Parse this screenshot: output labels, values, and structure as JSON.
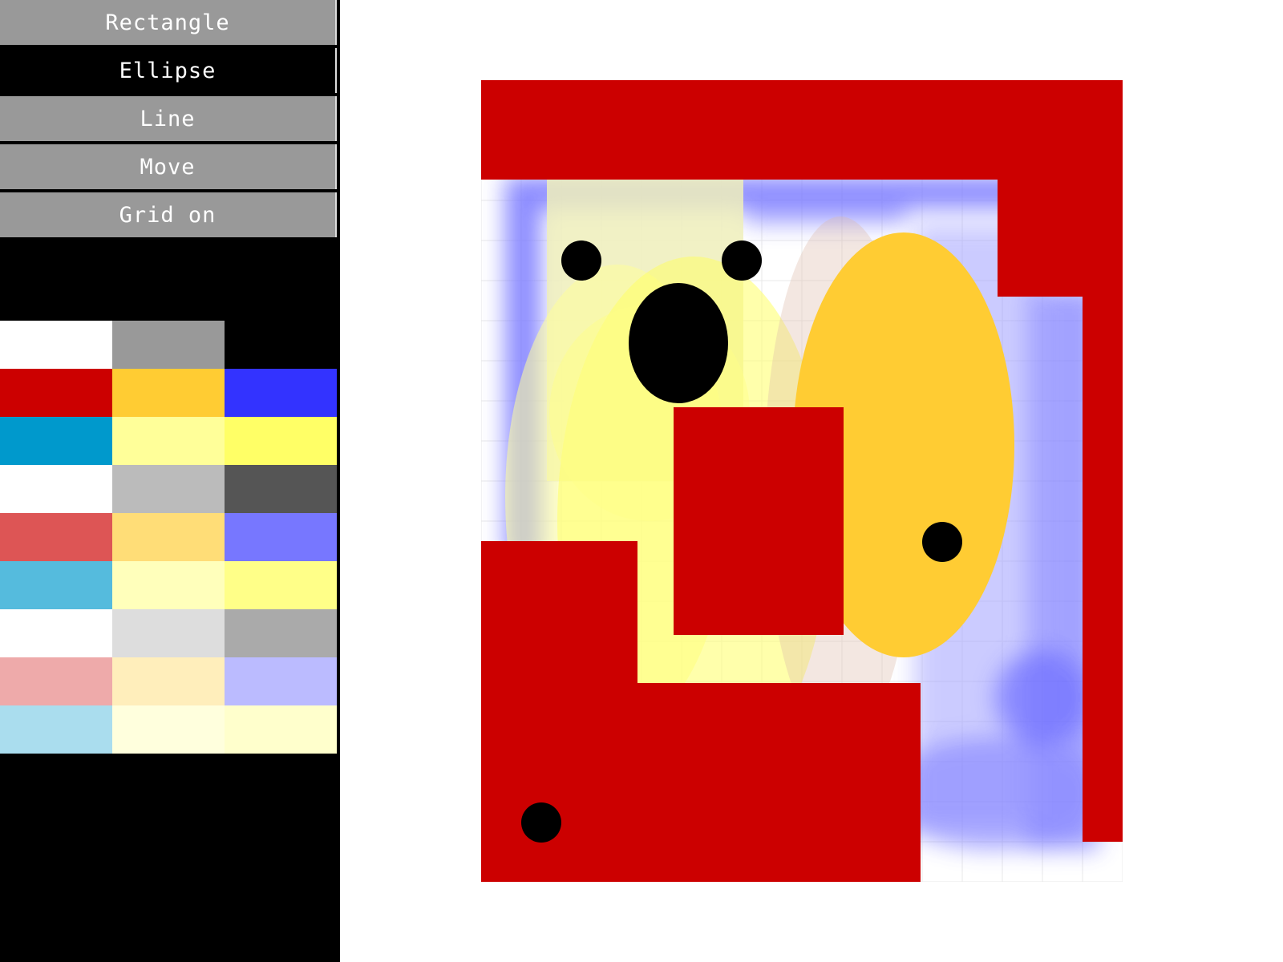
{
  "toolbar": {
    "items": [
      {
        "label": "Rectangle",
        "state": "inactive"
      },
      {
        "label": "Ellipse",
        "state": "selected"
      },
      {
        "label": "Line",
        "state": "inactive"
      },
      {
        "label": "Move",
        "state": "inactive"
      },
      {
        "label": "Grid on",
        "state": "inactive"
      }
    ]
  },
  "colors": {
    "button_inactive": "#999999",
    "button_selected": "#000000",
    "sidebar_bg": "#000000"
  },
  "palette": [
    "#ffffff",
    "#999999",
    "#000000",
    "#cc0000",
    "#ffcc33",
    "#3333ff",
    "#0099cc",
    "#ffff99",
    "#ffff66",
    "#ffffff",
    "#bbbbbb",
    "#555555",
    "#dd5555",
    "#ffdd77",
    "#7777ff",
    "#55bbdd",
    "#ffffbb",
    "#ffff88",
    "#ffffff",
    "#dddddd",
    "#aaaaaa",
    "#eeaaaa",
    "#ffeebb",
    "#bbbbff",
    "#aaddee",
    "#ffffdd",
    "#ffffcc"
  ],
  "canvas": {
    "background": "#ffffff",
    "grid_color": "#e8e8e8",
    "main_color": "#cc0000",
    "accent_colors": [
      "#ffcc33",
      "#ffff66",
      "#3333ff",
      "#000000"
    ]
  }
}
